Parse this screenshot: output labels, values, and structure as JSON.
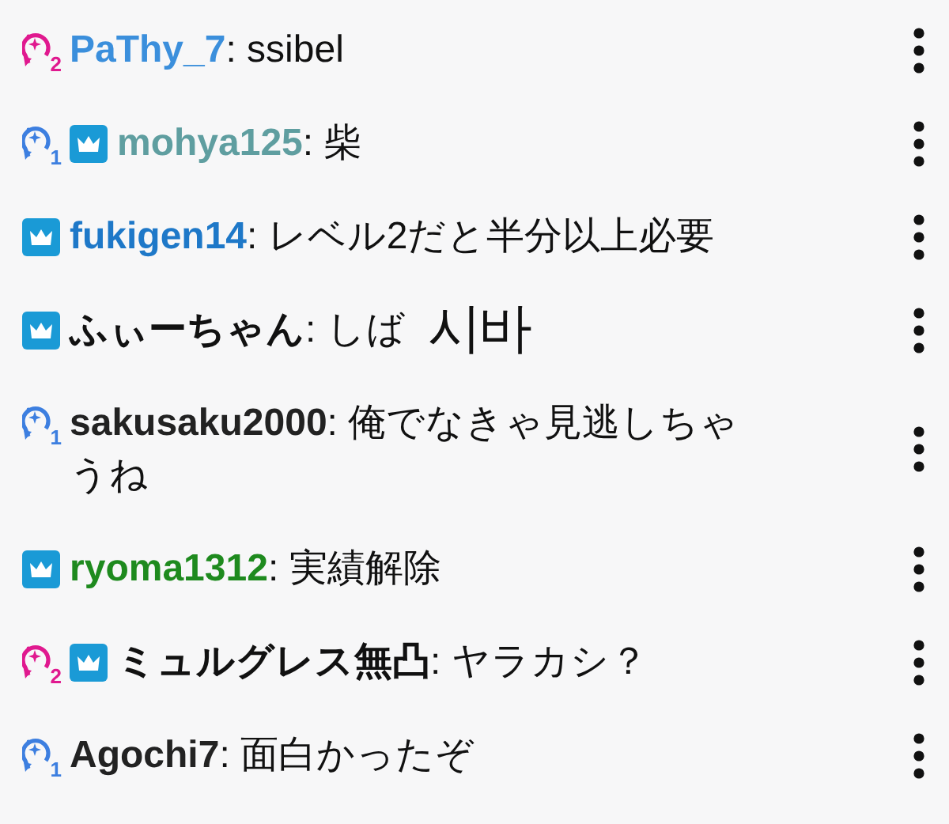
{
  "messages": [
    {
      "badges": [
        {
          "kind": "streak",
          "label": "2",
          "color": "#e0198f"
        }
      ],
      "user": "PaThy_7",
      "color": "#3b8fdc",
      "text": ": ssibel"
    },
    {
      "badges": [
        {
          "kind": "streak",
          "label": "1",
          "color": "#3d7fe0"
        },
        {
          "kind": "crown"
        }
      ],
      "user": "mohya125",
      "color": "#5f9ea0",
      "text": ": 柴"
    },
    {
      "badges": [
        {
          "kind": "crown"
        }
      ],
      "user": "fukigen14",
      "color": "#1e78c8",
      "text": ": レベル2だと半分以上必要"
    },
    {
      "badges": [
        {
          "kind": "crown"
        }
      ],
      "user": "ふぃーちゃん",
      "color": "#111111",
      "text": ": しば",
      "emote": "시바"
    },
    {
      "badges": [
        {
          "kind": "streak",
          "label": "1",
          "color": "#3d7fe0"
        }
      ],
      "user": "sakusaku2000",
      "color": "#222222",
      "text": ": 俺でなきゃ見逃しちゃうね"
    },
    {
      "badges": [
        {
          "kind": "crown"
        }
      ],
      "user": "ryoma1312",
      "color": "#1e8a1e",
      "text": ": 実績解除"
    },
    {
      "badges": [
        {
          "kind": "streak",
          "label": "2",
          "color": "#e0198f"
        },
        {
          "kind": "crown"
        }
      ],
      "user": "ミュルグレス無凸",
      "color": "#111111",
      "text": ": ヤラカシ？"
    },
    {
      "badges": [
        {
          "kind": "streak",
          "label": "1",
          "color": "#3d7fe0"
        }
      ],
      "user": "Agochi7",
      "color": "#222222",
      "text": ": 面白かったぞ"
    }
  ]
}
